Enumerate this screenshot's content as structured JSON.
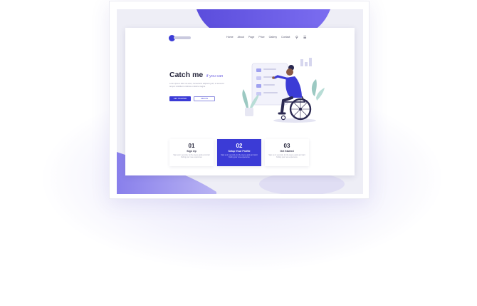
{
  "header": {
    "logo_icon": "brand-logo",
    "nav": [
      "Home",
      "About",
      "Page",
      "Price",
      "Gallery",
      "Contact"
    ],
    "search_icon": "search-icon",
    "menu_icon": "menu-icon"
  },
  "hero": {
    "title": "Catch me",
    "title_suffix": "if you can",
    "subtitle": "Lorem ipsum dolor sit amet, consectetur adipiscing elit, to eiusmod tempor incididunt ut labore et dolore magna.",
    "primary_button": "GET STARTED",
    "secondary_button": "SIGN IN",
    "illustration": "wheelchair-user-illustration"
  },
  "steps": [
    {
      "number": "01",
      "title": "Sign Up",
      "description": "Sign up in seconds, do the steps easily and start finding your new experience"
    },
    {
      "number": "02",
      "title": "Setup Your Profile",
      "description": "Sign up in seconds, do the steps easily and start finding your new experience"
    },
    {
      "number": "03",
      "title": "Get Started",
      "description": "Sign up in seconds, do the steps easily and start finding your new experience"
    }
  ],
  "colors": {
    "accent": "#3b3bd6",
    "accent_light": "#8f8fe0",
    "background_tint": "#eeeef6"
  }
}
